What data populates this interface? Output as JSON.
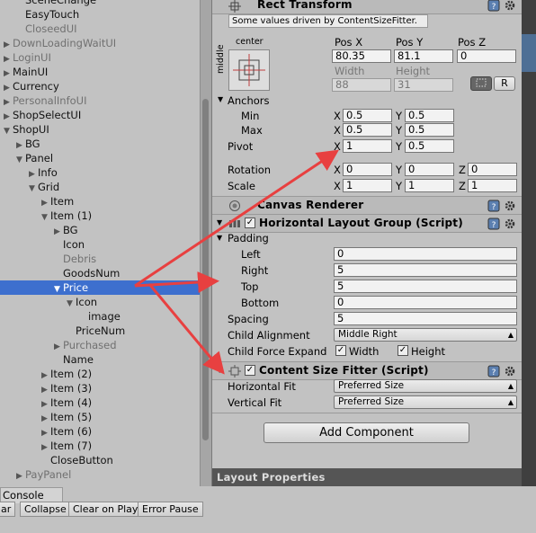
{
  "hierarchy": [
    {
      "label": "SceneChange",
      "depth": 1,
      "arrow": "",
      "inactive": false,
      "selected": false
    },
    {
      "label": "EasyTouch",
      "depth": 1,
      "arrow": "",
      "inactive": false,
      "selected": false
    },
    {
      "label": "CloseedUI",
      "depth": 1,
      "arrow": "",
      "inactive": true,
      "selected": false
    },
    {
      "label": "DownLoadingWaitUI",
      "depth": 0,
      "arrow": "▶",
      "inactive": true,
      "selected": false
    },
    {
      "label": "LoginUI",
      "depth": 0,
      "arrow": "▶",
      "inactive": true,
      "selected": false
    },
    {
      "label": "MainUI",
      "depth": 0,
      "arrow": "▶",
      "inactive": false,
      "selected": false
    },
    {
      "label": "Currency",
      "depth": 0,
      "arrow": "▶",
      "inactive": false,
      "selected": false
    },
    {
      "label": "PersonalInfoUI",
      "depth": 0,
      "arrow": "▶",
      "inactive": true,
      "selected": false
    },
    {
      "label": "ShopSelectUI",
      "depth": 0,
      "arrow": "▶",
      "inactive": false,
      "selected": false
    },
    {
      "label": "ShopUI",
      "depth": 0,
      "arrow": "▼",
      "inactive": false,
      "selected": false
    },
    {
      "label": "BG",
      "depth": 1,
      "arrow": "▶",
      "inactive": false,
      "selected": false
    },
    {
      "label": "Panel",
      "depth": 1,
      "arrow": "▼",
      "inactive": false,
      "selected": false
    },
    {
      "label": "Info",
      "depth": 2,
      "arrow": "▶",
      "inactive": false,
      "selected": false
    },
    {
      "label": "Grid",
      "depth": 2,
      "arrow": "▼",
      "inactive": false,
      "selected": false
    },
    {
      "label": "Item",
      "depth": 3,
      "arrow": "▶",
      "inactive": false,
      "selected": false
    },
    {
      "label": "Item (1)",
      "depth": 3,
      "arrow": "▼",
      "inactive": false,
      "selected": false
    },
    {
      "label": "BG",
      "depth": 4,
      "arrow": "▶",
      "inactive": false,
      "selected": false
    },
    {
      "label": "Icon",
      "depth": 4,
      "arrow": "",
      "inactive": false,
      "selected": false
    },
    {
      "label": "Debris",
      "depth": 4,
      "arrow": "",
      "inactive": true,
      "selected": false
    },
    {
      "label": "GoodsNum",
      "depth": 4,
      "arrow": "",
      "inactive": false,
      "selected": false
    },
    {
      "label": "Price",
      "depth": 4,
      "arrow": "▼",
      "inactive": false,
      "selected": true
    },
    {
      "label": "Icon",
      "depth": 5,
      "arrow": "▼",
      "inactive": false,
      "selected": false
    },
    {
      "label": "image",
      "depth": 6,
      "arrow": "",
      "inactive": false,
      "selected": false
    },
    {
      "label": "PriceNum",
      "depth": 5,
      "arrow": "",
      "inactive": false,
      "selected": false
    },
    {
      "label": "Purchased",
      "depth": 4,
      "arrow": "▶",
      "inactive": true,
      "selected": false
    },
    {
      "label": "Name",
      "depth": 4,
      "arrow": "",
      "inactive": false,
      "selected": false
    },
    {
      "label": "Item (2)",
      "depth": 3,
      "arrow": "▶",
      "inactive": false,
      "selected": false
    },
    {
      "label": "Item (3)",
      "depth": 3,
      "arrow": "▶",
      "inactive": false,
      "selected": false
    },
    {
      "label": "Item (4)",
      "depth": 3,
      "arrow": "▶",
      "inactive": false,
      "selected": false
    },
    {
      "label": "Item (5)",
      "depth": 3,
      "arrow": "▶",
      "inactive": false,
      "selected": false
    },
    {
      "label": "Item (6)",
      "depth": 3,
      "arrow": "▶",
      "inactive": false,
      "selected": false
    },
    {
      "label": "Item (7)",
      "depth": 3,
      "arrow": "▶",
      "inactive": false,
      "selected": false
    },
    {
      "label": "CloseButton",
      "depth": 3,
      "arrow": "",
      "inactive": false,
      "selected": false
    },
    {
      "label": "PayPanel",
      "depth": 1,
      "arrow": "▶",
      "inactive": true,
      "selected": false
    }
  ],
  "rect_transform": {
    "title": "Rect Transform",
    "note": "Some values driven by ContentSizeFitter.",
    "anchor_preset_top": "center",
    "anchor_preset_side": "middle",
    "col_posx": "Pos X",
    "col_posy": "Pos Y",
    "col_posz": "Pos Z",
    "posx": "80.35",
    "posy": "81.1",
    "posz": "0",
    "col_width": "Width",
    "col_height": "Height",
    "width": "88",
    "height": "31",
    "r_button": "R",
    "anchors_label": "Anchors",
    "min_label": "Min",
    "max_label": "Max",
    "min_x": "0.5",
    "min_y": "0.5",
    "max_x": "0.5",
    "max_y": "0.5",
    "pivot_label": "Pivot",
    "pivot_x": "1",
    "pivot_y": "0.5",
    "rotation_label": "Rotation",
    "rot_x": "0",
    "rot_y": "0",
    "rot_z": "0",
    "scale_label": "Scale",
    "scale_x": "1",
    "scale_y": "1",
    "scale_z": "1",
    "axis_x": "X",
    "axis_y": "Y",
    "axis_z": "Z"
  },
  "canvas_renderer": {
    "title": "Canvas Renderer"
  },
  "horizontal_layout": {
    "title": "Horizontal Layout Group (Script)",
    "padding_label": "Padding",
    "left_label": "Left",
    "left": "0",
    "right_label": "Right",
    "right": "5",
    "top_label": "Top",
    "top": "5",
    "bottom_label": "Bottom",
    "bottom": "0",
    "spacing_label": "Spacing",
    "spacing": "5",
    "alignment_label": "Child Alignment",
    "alignment": "Middle Right",
    "force_expand_label": "Child Force Expand",
    "width_label": "Width",
    "height_label": "Height",
    "check": "✓"
  },
  "content_size_fitter": {
    "title": "Content Size Fitter (Script)",
    "hfit_label": "Horizontal Fit",
    "hfit": "Preferred Size",
    "vfit_label": "Vertical Fit",
    "vfit": "Preferred Size"
  },
  "add_component": "Add Component",
  "layout_properties": "Layout Properties",
  "console": {
    "tab": "Console",
    "clear": "ar",
    "collapse": "Collapse",
    "clear_on_play": "Clear on Play",
    "error_pause": "Error Pause"
  },
  "colors": {
    "selection": "#3d6fce",
    "arrow": "#e84040"
  }
}
